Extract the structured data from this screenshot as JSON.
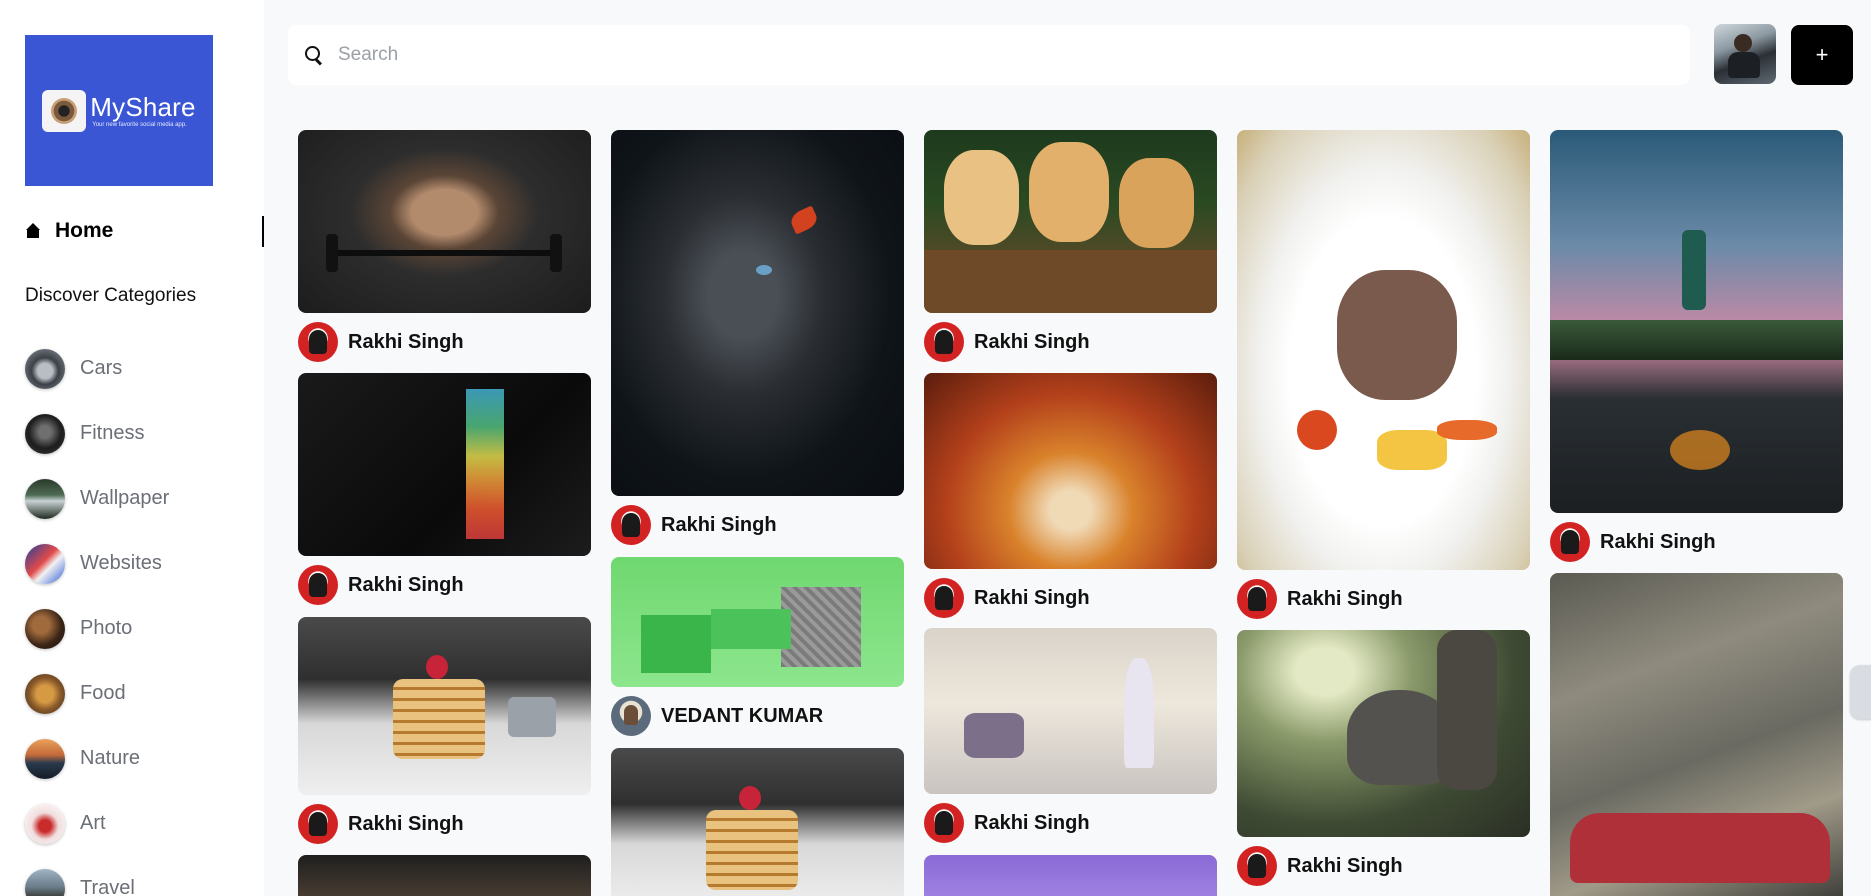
{
  "app": {
    "name": "MyShare",
    "tagline": "Your new favorite social media app."
  },
  "sidebar": {
    "home_label": "Home",
    "categories_heading": "Discover Categories",
    "categories": [
      {
        "label": "Cars"
      },
      {
        "label": "Fitness"
      },
      {
        "label": "Wallpaper"
      },
      {
        "label": "Websites"
      },
      {
        "label": "Photo"
      },
      {
        "label": "Food"
      },
      {
        "label": "Nature"
      },
      {
        "label": "Art"
      },
      {
        "label": "Travel"
      }
    ]
  },
  "search": {
    "placeholder": "Search"
  },
  "header": {
    "add_label": "+"
  },
  "pins": [
    {
      "user": "Rakhi Singh",
      "icon": "bodybuilder-photo"
    },
    {
      "user": "Rakhi Singh",
      "icon": "motivation-wallpaper"
    },
    {
      "user": "Rakhi Singh",
      "icon": "pancakes-photo"
    },
    {
      "user": "Rakhi Singh",
      "icon": "cat-butterfly-photo"
    },
    {
      "user": "VEDANT KUMAR",
      "icon": "3d-building-model"
    },
    {
      "user": "Rakhi Singh",
      "icon": "puppies-photo"
    },
    {
      "user": "Rakhi Singh",
      "icon": "autumn-forest-photo"
    },
    {
      "user": "Rakhi Singh",
      "icon": "fantasy-girl-clouds"
    },
    {
      "user": "Rakhi Singh",
      "icon": "lamb-chops-photo"
    },
    {
      "user": "Rakhi Singh",
      "icon": "elephant-photo"
    },
    {
      "user": "Rakhi Singh",
      "icon": "road-traveler-photo"
    }
  ]
}
